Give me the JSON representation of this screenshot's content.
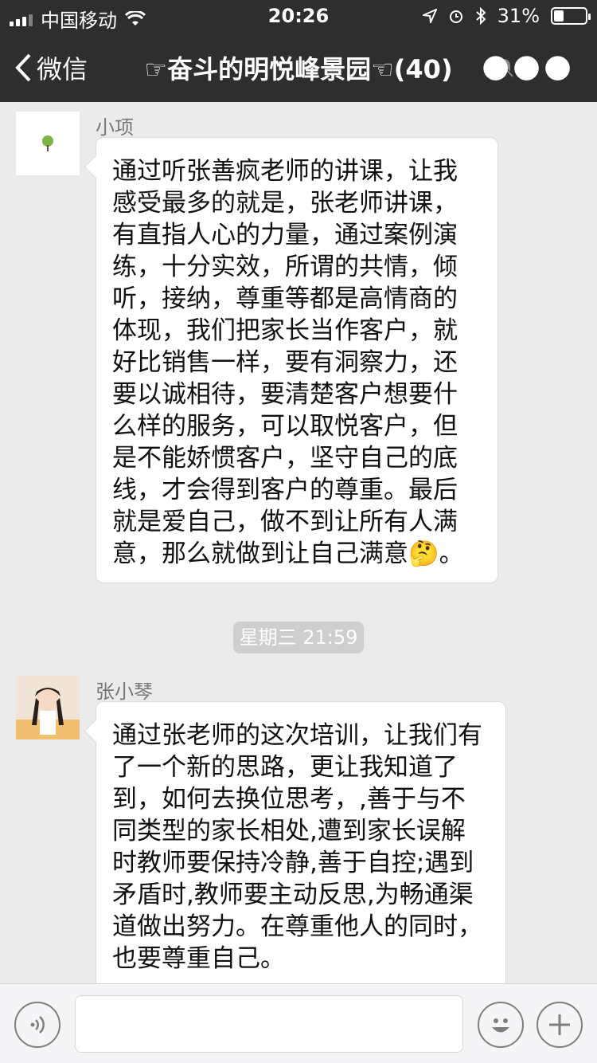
{
  "status_bar": {
    "carrier": "中国移动",
    "time": "20:26",
    "battery": "31%"
  },
  "nav": {
    "back_label": "微信",
    "title": "☞奋斗的明悦峰景园☜(40)"
  },
  "messages": [
    {
      "sender": "小项",
      "avatar": "tree-avatar",
      "text": "通过听张善疯老师的讲课，让我感受最多的就是，张老师讲课，有直指人心的力量，通过案例演练，十分实效，所谓的共情，倾听，接纳，尊重等都是高情商的体现，我们把家长当作客户，就好比销售一样，要有洞察力，还要以诚相待，要清楚客户想要什么样的服务，可以取悦客户，但是不能娇惯客户，坚守自己的底线，才会得到客户的尊重。最后就是爱自己，做不到让所有人满意，那么就做到让自己满意🤔。"
    },
    {
      "timestamp": "星期三 21:59"
    },
    {
      "sender": "张小琴",
      "avatar": "girl-photo-avatar",
      "text": "通过张老师的这次培训，让我们有了一个新的思路，更让我知道了到，如何去换位思考，,善于与不同类型的家长相处,遭到家长误解时教师要保持冷静,善于自控;遇到矛盾时,教师要主动反思,为畅通渠道做出努力。在尊重他人的同时，也要尊重自己。"
    }
  ],
  "input_bar": {
    "placeholder": ""
  },
  "colors": {
    "nav_bg": "#2e2e2e",
    "chat_bg": "#ebebeb",
    "bubble_bg": "#ffffff",
    "timestamp_bg": "#cecece"
  }
}
